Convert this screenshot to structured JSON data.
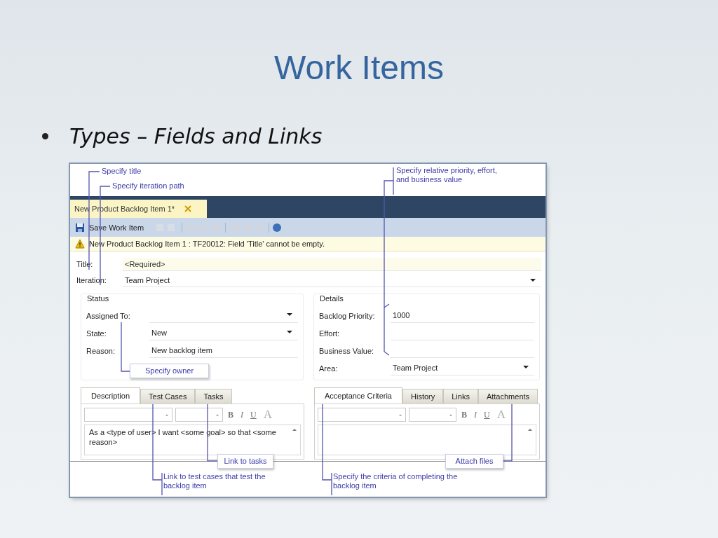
{
  "slide": {
    "title": "Work Items",
    "bullet": "Types – Fields and Links"
  },
  "screenshot": {
    "document_tab": {
      "label": "New Product Backlog Item 1*"
    },
    "toolbar": {
      "save": "Save Work Item"
    },
    "warning": "New Product Backlog Item 1 : TF20012: Field 'Title' cannot be empty.",
    "top_fields": [
      {
        "label": "Title:",
        "placeholder": "<Required>",
        "kind": "text"
      },
      {
        "label": "Iteration:",
        "value": "Team Project",
        "kind": "dropdown"
      }
    ],
    "groups": [
      {
        "heading": "Status",
        "fields": [
          {
            "label": "Assigned To:",
            "kind": "dropdown"
          },
          {
            "label": "State:",
            "value": "New",
            "kind": "dropdown"
          },
          {
            "label": "Reason:",
            "value": "New backlog item",
            "kind": "text"
          }
        ]
      },
      {
        "heading": "Details",
        "fields": [
          {
            "label": "Backlog Priority:",
            "value": "1000",
            "kind": "text"
          },
          {
            "label": "Effort:",
            "kind": "text"
          },
          {
            "label": "Business Value:",
            "kind": "text"
          },
          {
            "label": "Area:",
            "value": "Team Project",
            "kind": "dropdown"
          }
        ]
      }
    ],
    "panels": [
      {
        "tabs": [
          {
            "label": "Description",
            "selected": true
          },
          {
            "label": "Test Cases",
            "selected": false
          },
          {
            "label": "Tasks",
            "selected": false
          }
        ],
        "format_buttons": [
          "B",
          "I",
          "U",
          "A"
        ],
        "content": "As a <type of user> I want <some goal> so that <some reason>"
      },
      {
        "tabs": [
          {
            "label": "Acceptance Criteria",
            "selected": true
          },
          {
            "label": "History",
            "selected": false
          },
          {
            "label": "Links",
            "selected": false
          },
          {
            "label": "Attachments",
            "selected": false
          }
        ],
        "format_buttons": [
          "B",
          "I",
          "U",
          "A"
        ]
      }
    ],
    "callouts": [
      {
        "text": "Specify title",
        "kind": "plain"
      },
      {
        "text": "Specify iteration path",
        "kind": "plain"
      },
      {
        "text": "Specify relative priority, effort, and business value",
        "kind": "plain"
      },
      {
        "text": "Specify owner",
        "kind": "boxed"
      },
      {
        "text": "Link to tasks",
        "kind": "boxed"
      },
      {
        "text": "Attach files",
        "kind": "boxed"
      },
      {
        "text": "Link to test cases that test the backlog item",
        "kind": "plain"
      },
      {
        "text": "Specify the criteria of completing the backlog item",
        "kind": "plain"
      }
    ]
  }
}
